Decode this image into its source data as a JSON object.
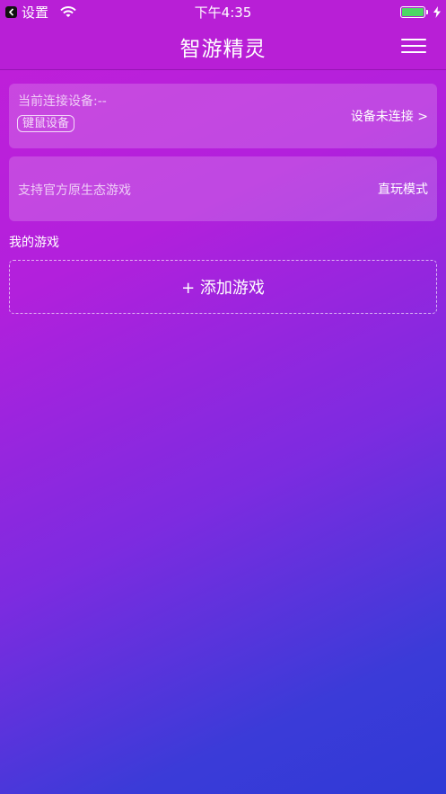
{
  "status_bar": {
    "back_label": "设置",
    "time": "下午4:35",
    "battery_level": 1.0
  },
  "header": {
    "title": "智游精灵",
    "menu_icon": "hamburger-menu-icon"
  },
  "device_card": {
    "label": "当前连接设备:--",
    "device_type": "键鼠设备",
    "status": "设备未连接 >"
  },
  "mode_card": {
    "label": "支持官方原生态游戏",
    "mode": "直玩模式"
  },
  "my_games": {
    "title": "我的游戏",
    "add_label": "+ 添加游戏"
  },
  "colors": {
    "header_bg": "#b81fd6",
    "gradient_start": "#c21fd8",
    "gradient_end": "#2f3ad6",
    "battery_fill": "#4cd964"
  }
}
